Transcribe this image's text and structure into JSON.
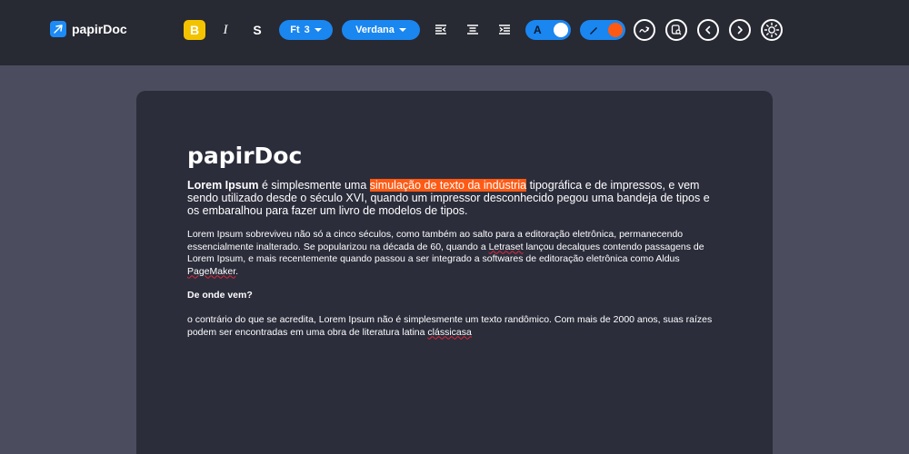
{
  "app": {
    "name": "papirDoc"
  },
  "toolbar": {
    "bold_label": "B",
    "italic_label": "I",
    "strike_label": "S",
    "font_size_label": "Ft",
    "font_size_value": "3",
    "font_family_value": "Verdana",
    "text_color_label": "A",
    "text_color": "#ffffff",
    "highlight_color": "#ff5a14",
    "accent": "#1a86f0",
    "bold_active_color": "#f3c300"
  },
  "document": {
    "title": "papirDoc",
    "lead": {
      "bold": "Lorem Ipsum",
      "before_highlight": " é simplesmente uma ",
      "highlight": "simulação de texto da indústria",
      "after_highlight": " tipográfica e de impressos, e vem sendo utilizado desde o século XVI, quando um impressor desconhecido pegou uma bandeja de tipos e os embaralhou para fazer um livro de modelos de tipos."
    },
    "para1": {
      "part1": "Lorem Ipsum sobreviveu não só a cinco séculos, como também ao salto para a editoração eletrônica, permanecendo essencialmente inalterado. Se popularizou na década de 60, quando a ",
      "word1": "Letraset",
      "part2": " lançou decalques contendo passagens de Lorem Ipsum, e mais recentemente quando passou a ser integrado a softwares de editoração eletrônica como Aldus ",
      "word2": "PageMaker",
      "part3": "."
    },
    "subheading": "De onde vem?",
    "para2": {
      "part1": "o contrário do que se acredita, Lorem Ipsum não é simplesmente um texto randômico. Com mais de 2000 anos, suas raízes podem ser encontradas em uma obra de literatura latina ",
      "word1": "clássicasa"
    }
  }
}
